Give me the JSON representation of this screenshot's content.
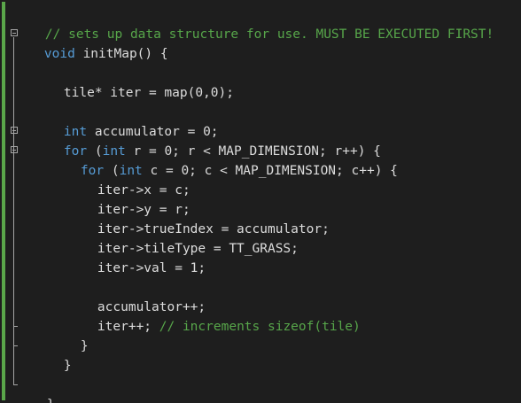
{
  "code": {
    "l1_comment": "// sets up data structure for use. MUST BE EXECUTED FIRST!",
    "l2_kw": "void",
    "l2_txt": " initMap() {",
    "l4_txt": "tile* iter = map(0,0);",
    "l6_kw": "int",
    "l6_txt": " accumulator = 0;",
    "l7_kw1": "for",
    "l7_txt1": " (",
    "l7_kw2": "int",
    "l7_txt2": " r = 0; r < MAP_DIMENSION; r++) {",
    "l8_kw1": "for",
    "l8_txt1": " (",
    "l8_kw2": "int",
    "l8_txt2": " c = 0; c < MAP_DIMENSION; c++) {",
    "l9_txt": "iter->x = c;",
    "l10_txt": "iter->y = r;",
    "l11_txt": "iter->trueIndex = accumulator;",
    "l12_txt": "iter->tileType = TT_GRASS;",
    "l13_txt": "iter->val = 1;",
    "l15_txt": "accumulator++;",
    "l16_txt": "iter++; ",
    "l16_comment": "// increments sizeof(tile)",
    "l17_txt": "}",
    "l18_txt": "}",
    "l20_txt": "}"
  },
  "colors": {
    "background": "#1e1e1e",
    "keyword": "#569cd6",
    "comment": "#57a64a",
    "text": "#dcdcdc",
    "change_bar": "#5aa64a"
  },
  "icons": {
    "fold_marker": "collapse-minus-icon"
  }
}
